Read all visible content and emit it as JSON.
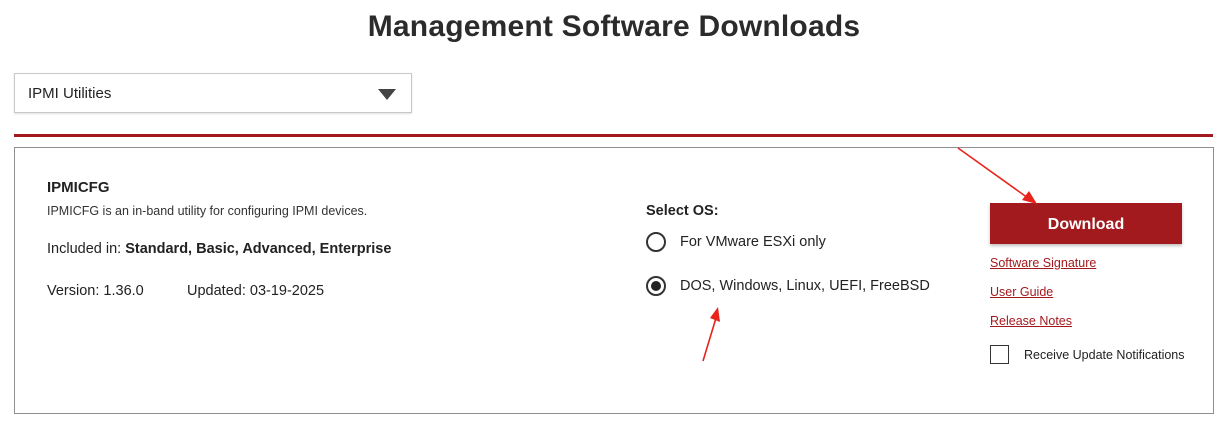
{
  "page": {
    "title": "Management Software Downloads"
  },
  "category_select": {
    "selected": "IPMI Utilities"
  },
  "colors": {
    "brand_red": "#a31a1e",
    "annotation_red": "#e8231b"
  },
  "product": {
    "name": "IPMICFG",
    "description": "IPMICFG is an in-band utility for configuring IPMI devices.",
    "included_label": "Included in: ",
    "included_value": "Standard, Basic, Advanced, Enterprise",
    "version_text": "Version: 1.36.0",
    "updated_text": "Updated: 03-19-2025"
  },
  "os_selection": {
    "heading": "Select OS:",
    "options": [
      {
        "label": "For VMware ESXi only",
        "selected": false
      },
      {
        "label": "DOS, Windows, Linux, UEFI, FreeBSD",
        "selected": true
      }
    ]
  },
  "actions": {
    "download_label": "Download",
    "links": [
      {
        "label": "Software Signature"
      },
      {
        "label": "User Guide"
      },
      {
        "label": "Release Notes"
      }
    ],
    "notify": {
      "label": "Receive Update Notifications",
      "checked": false
    }
  }
}
